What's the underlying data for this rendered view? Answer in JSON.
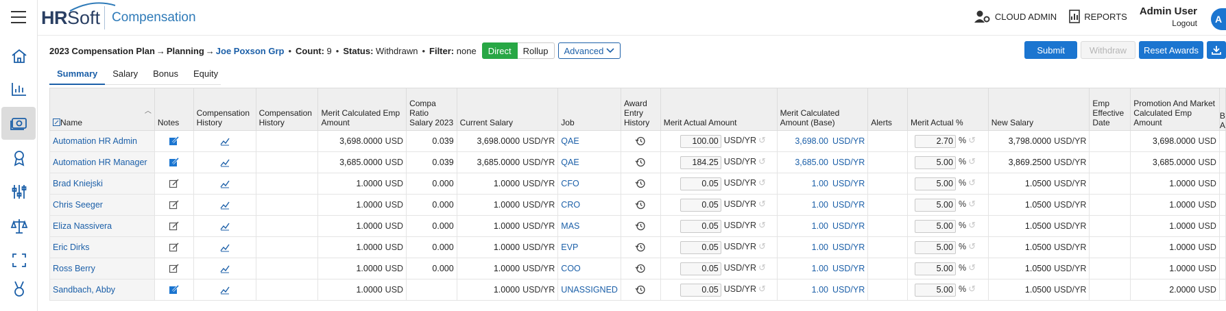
{
  "app": {
    "brand_hr": "HR",
    "brand_soft": "Soft",
    "module": "Compensation",
    "cloud_admin": "CLOUD ADMIN",
    "reports": "REPORTS",
    "user_name": "Admin User",
    "logout": "Logout",
    "avatar_initial": "A"
  },
  "sidebar": {
    "icons": [
      "menu-icon",
      "home-icon",
      "chart-icon",
      "money-icon",
      "award-icon",
      "sliders-icon",
      "scale-icon",
      "expand-icon",
      "medal-icon"
    ]
  },
  "crumbs": {
    "plan": "2023 Compensation Plan",
    "arrow1": "→",
    "phase": "Planning",
    "arrow2": "→",
    "group": "Joe Poxson Grp",
    "count_label": "Count:",
    "count": "9",
    "status_label": "Status:",
    "status": "Withdrawn",
    "filter_label": "Filter:",
    "filter": "none",
    "direct": "Direct",
    "rollup": "Rollup",
    "advanced": "Advanced"
  },
  "actions": {
    "submit": "Submit",
    "withdraw": "Withdraw",
    "reset": "Reset Awards"
  },
  "tabs": [
    "Summary",
    "Salary",
    "Bonus",
    "Equity"
  ],
  "columns": {
    "name": "Name",
    "notes": "Notes",
    "comp_history1": "Compensation History",
    "comp_history2": "Compensation History",
    "merit_calc": "Merit Calculated Emp Amount",
    "compa": "Compa Ratio Salary 2023",
    "current_salary": "Current Salary",
    "job": "Job",
    "award_hist": "Award Entry History",
    "merit_actual": "Merit Actual Amount",
    "merit_calc_base": "Merit Calculated Amount (Base)",
    "alerts": "Alerts",
    "merit_pct": "Merit Actual %",
    "new_salary": "New Salary",
    "emp_eff": "Emp Effective Date",
    "promo": "Promotion And Market Calculated Emp Amount",
    "cut": "B A"
  },
  "rows": [
    {
      "name": "Automation HR Admin",
      "note_filled": true,
      "merit_calc": "3,698.0000",
      "merit_calc_unit": "USD",
      "compa": "0.039",
      "cur": "3,698.0000",
      "cur_unit": "USD/YR",
      "job": "QAE",
      "merit_actual": "100.00",
      "ma_unit": "USD/YR",
      "base": "3,698.00",
      "base_unit": "USD/YR",
      "pct": "2.70",
      "pct_unit": "%",
      "new": "3,798.0000",
      "new_unit": "USD/YR",
      "promo": "3,698.0000",
      "promo_unit": "USD"
    },
    {
      "name": "Automation HR Manager",
      "note_filled": true,
      "merit_calc": "3,685.0000",
      "merit_calc_unit": "USD",
      "compa": "0.039",
      "cur": "3,685.0000",
      "cur_unit": "USD/YR",
      "job": "QAE",
      "merit_actual": "184.25",
      "ma_unit": "USD/YR",
      "base": "3,685.00",
      "base_unit": "USD/YR",
      "pct": "5.00",
      "pct_unit": "%",
      "new": "3,869.2500",
      "new_unit": "USD/YR",
      "promo": "3,685.0000",
      "promo_unit": "USD"
    },
    {
      "name": "Brad Kniejski",
      "note_filled": false,
      "merit_calc": "1.0000",
      "merit_calc_unit": "USD",
      "compa": "0.000",
      "cur": "1.0000",
      "cur_unit": "USD/YR",
      "job": "CFO",
      "merit_actual": "0.05",
      "ma_unit": "USD/YR",
      "base": "1.00",
      "base_unit": "USD/YR",
      "pct": "5.00",
      "pct_unit": "%",
      "new": "1.0500",
      "new_unit": "USD/YR",
      "promo": "1.0000",
      "promo_unit": "USD"
    },
    {
      "name": "Chris Seeger",
      "note_filled": false,
      "merit_calc": "1.0000",
      "merit_calc_unit": "USD",
      "compa": "0.000",
      "cur": "1.0000",
      "cur_unit": "USD/YR",
      "job": "CRO",
      "merit_actual": "0.05",
      "ma_unit": "USD/YR",
      "base": "1.00",
      "base_unit": "USD/YR",
      "pct": "5.00",
      "pct_unit": "%",
      "new": "1.0500",
      "new_unit": "USD/YR",
      "promo": "1.0000",
      "promo_unit": "USD"
    },
    {
      "name": "Eliza Nassivera",
      "note_filled": false,
      "merit_calc": "1.0000",
      "merit_calc_unit": "USD",
      "compa": "0.000",
      "cur": "1.0000",
      "cur_unit": "USD/YR",
      "job": "MAS",
      "merit_actual": "0.05",
      "ma_unit": "USD/YR",
      "base": "1.00",
      "base_unit": "USD/YR",
      "pct": "5.00",
      "pct_unit": "%",
      "new": "1.0500",
      "new_unit": "USD/YR",
      "promo": "1.0000",
      "promo_unit": "USD"
    },
    {
      "name": "Eric Dirks",
      "note_filled": false,
      "merit_calc": "1.0000",
      "merit_calc_unit": "USD",
      "compa": "0.000",
      "cur": "1.0000",
      "cur_unit": "USD/YR",
      "job": "EVP",
      "merit_actual": "0.05",
      "ma_unit": "USD/YR",
      "base": "1.00",
      "base_unit": "USD/YR",
      "pct": "5.00",
      "pct_unit": "%",
      "new": "1.0500",
      "new_unit": "USD/YR",
      "promo": "1.0000",
      "promo_unit": "USD"
    },
    {
      "name": "Ross Berry",
      "note_filled": false,
      "merit_calc": "1.0000",
      "merit_calc_unit": "USD",
      "compa": "0.000",
      "cur": "1.0000",
      "cur_unit": "USD/YR",
      "job": "COO",
      "merit_actual": "0.05",
      "ma_unit": "USD/YR",
      "base": "1.00",
      "base_unit": "USD/YR",
      "pct": "5.00",
      "pct_unit": "%",
      "new": "1.0500",
      "new_unit": "USD/YR",
      "promo": "1.0000",
      "promo_unit": "USD"
    },
    {
      "name": "Sandbach, Abby",
      "note_filled": true,
      "merit_calc": "1.0000",
      "merit_calc_unit": "USD",
      "compa": "",
      "cur": "1.0000",
      "cur_unit": "USD/YR",
      "job": "UNASSIGNED",
      "merit_actual": "0.05",
      "ma_unit": "USD/YR",
      "base": "1.00",
      "base_unit": "USD/YR",
      "pct": "5.00",
      "pct_unit": "%",
      "new": "1.0500",
      "new_unit": "USD/YR",
      "promo": "2.0000",
      "promo_unit": "USD"
    }
  ]
}
